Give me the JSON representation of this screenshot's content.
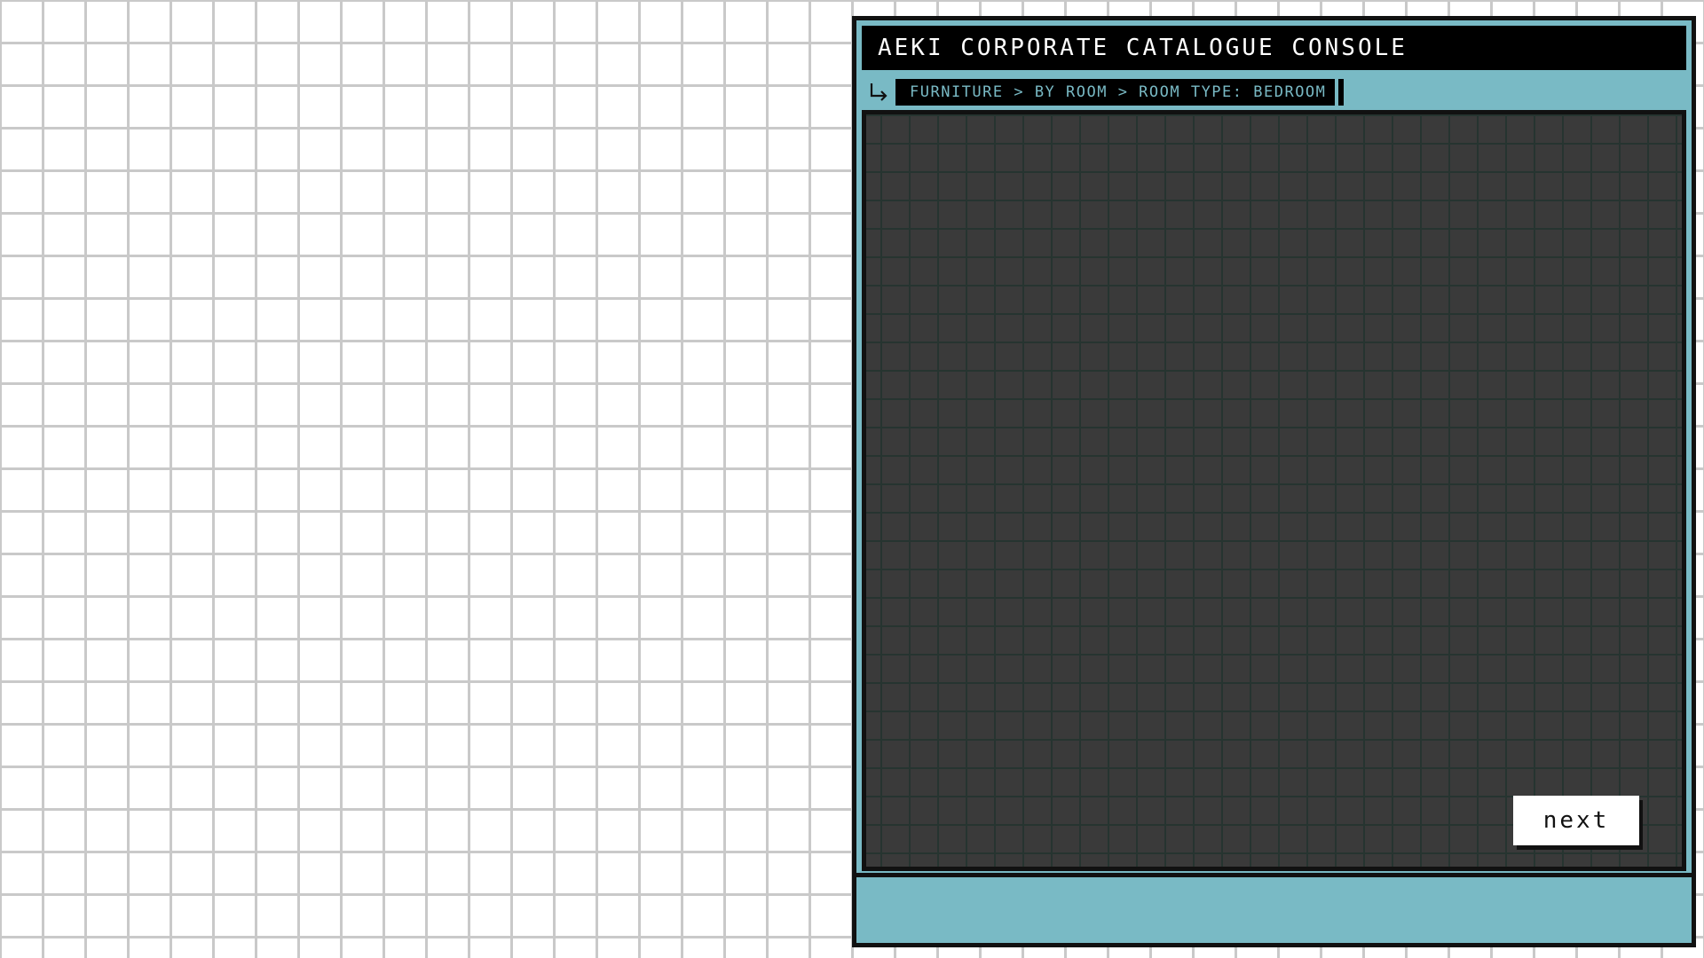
{
  "window": {
    "title": "AEKI CORPORATE CATALOGUE CONSOLE"
  },
  "breadcrumb": {
    "icon": "return-arrow-icon",
    "path": "FURNITURE > BY ROOM > ROOM TYPE: BEDROOM"
  },
  "content": {
    "next_label": "next"
  },
  "colors": {
    "frame": "#79bac5",
    "title_bar": "#000000",
    "title_text": "#ffffff",
    "breadcrumb_text": "#79bac5",
    "panel_bg": "#3a3a3a",
    "panel_grid": "#263430",
    "button_bg": "#ffffff",
    "page_bg": "#ffffff",
    "page_grid": "#c9c9c9"
  }
}
